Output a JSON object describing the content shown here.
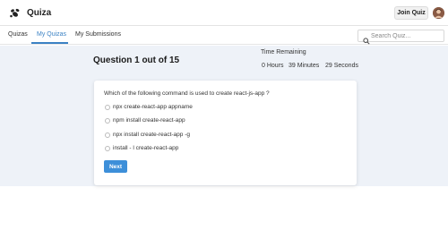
{
  "app": {
    "name": "Quiza",
    "icon": "bee-logo-icon"
  },
  "header": {
    "join_label": "Join Quiz",
    "avatar_icon": "user-avatar"
  },
  "nav": {
    "tabs": [
      {
        "label": "Quizas",
        "active": false
      },
      {
        "label": "My Quizas",
        "active": true
      },
      {
        "label": "My Submissions",
        "active": false
      }
    ],
    "search_placeholder": "Search Quiz...",
    "search_icon": "search-icon",
    "accent": "#3b82c4"
  },
  "quiz": {
    "heading": "Question 1 out of 15",
    "time_label": "Time Remaining",
    "time": {
      "hours": "0 Hours",
      "minutes": "39 Minutes",
      "seconds": "29 Seconds"
    },
    "question": "Which of the following command is used to create react-js-app ?",
    "options": [
      "npx create-react-app appname",
      "npm install create-react-app",
      "npx install create-react-app -g",
      "install - l create-react-app"
    ],
    "next_label": "Next"
  },
  "colors": {
    "page_background": "#eef2f8",
    "button_primary": "#3d8fd9"
  }
}
